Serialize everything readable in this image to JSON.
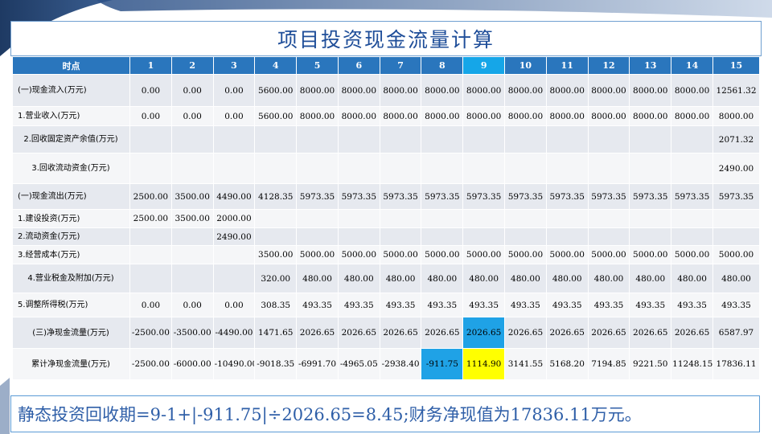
{
  "title": "项目投资现金流量计算",
  "header": {
    "label": "时点",
    "periods": [
      "1",
      "2",
      "3",
      "4",
      "5",
      "6",
      "7",
      "8",
      "9",
      "10",
      "11",
      "12",
      "13",
      "14",
      "15"
    ]
  },
  "rows": [
    {
      "label": "(一)现金流入(万元)",
      "values": [
        "0.00",
        "0.00",
        "0.00",
        "5600.00",
        "8000.00",
        "8000.00",
        "8000.00",
        "8000.00",
        "8000.00",
        "8000.00",
        "8000.00",
        "8000.00",
        "8000.00",
        "8000.00",
        "12561.32"
      ]
    },
    {
      "label": "1.营业收入(万元)",
      "values": [
        "0.00",
        "0.00",
        "0.00",
        "5600.00",
        "8000.00",
        "8000.00",
        "8000.00",
        "8000.00",
        "8000.00",
        "8000.00",
        "8000.00",
        "8000.00",
        "8000.00",
        "8000.00",
        "8000.00"
      ]
    },
    {
      "label": "2.回收固定资产余值(万元)",
      "values": [
        "",
        "",
        "",
        "",
        "",
        "",
        "",
        "",
        "",
        "",
        "",
        "",
        "",
        "",
        "2071.32"
      ]
    },
    {
      "label": "3.回收流动资金(万元)",
      "values": [
        "",
        "",
        "",
        "",
        "",
        "",
        "",
        "",
        "",
        "",
        "",
        "",
        "",
        "",
        "2490.00"
      ]
    },
    {
      "label": "(一)现金流出(万元)",
      "values": [
        "2500.00",
        "3500.00",
        "4490.00",
        "4128.35",
        "5973.35",
        "5973.35",
        "5973.35",
        "5973.35",
        "5973.35",
        "5973.35",
        "5973.35",
        "5973.35",
        "5973.35",
        "5973.35",
        "5973.35"
      ]
    },
    {
      "label": "1.建设投资(万元)",
      "values": [
        "2500.00",
        "3500.00",
        "2000.00",
        "",
        "",
        "",
        "",
        "",
        "",
        "",
        "",
        "",
        "",
        "",
        ""
      ]
    },
    {
      "label": "2.流动资金(万元)",
      "values": [
        "",
        "",
        "2490.00",
        "",
        "",
        "",
        "",
        "",
        "",
        "",
        "",
        "",
        "",
        "",
        ""
      ]
    },
    {
      "label": "3.经营成本(万元)",
      "values": [
        "",
        "",
        "",
        "3500.00",
        "5000.00",
        "5000.00",
        "5000.00",
        "5000.00",
        "5000.00",
        "5000.00",
        "5000.00",
        "5000.00",
        "5000.00",
        "5000.00",
        "5000.00"
      ]
    },
    {
      "label": "4.营业税金及附加(万元)",
      "values": [
        "",
        "",
        "",
        "320.00",
        "480.00",
        "480.00",
        "480.00",
        "480.00",
        "480.00",
        "480.00",
        "480.00",
        "480.00",
        "480.00",
        "480.00",
        "480.00"
      ]
    },
    {
      "label": "5.调整所得税(万元)",
      "values": [
        "0.00",
        "0.00",
        "0.00",
        "308.35",
        "493.35",
        "493.35",
        "493.35",
        "493.35",
        "493.35",
        "493.35",
        "493.35",
        "493.35",
        "493.35",
        "493.35",
        "493.35"
      ]
    },
    {
      "label": "(三)净现金流量(万元)",
      "values": [
        "-2500.00",
        "-3500.00",
        "-4490.00",
        "1471.65",
        "2026.65",
        "2026.65",
        "2026.65",
        "2026.65",
        "2026.65",
        "2026.65",
        "2026.65",
        "2026.65",
        "2026.65",
        "2026.65",
        "6587.97"
      ]
    },
    {
      "label": "累计净现金流量(万元)",
      "values": [
        "-2500.00",
        "-6000.00",
        "-10490.00",
        "-9018.35",
        "-6991.70",
        "-4965.05",
        "-2938.40",
        "-911.75",
        "1114.90",
        "3141.55",
        "5168.20",
        "7194.85",
        "9221.50",
        "11248.15",
        "17836.11"
      ]
    }
  ],
  "highlight_colors": {
    "header_current": "#15a6e8",
    "cell_blue": "#1fa2e6",
    "cell_yellow": "#ffff00"
  },
  "footer": "静态投资回收期=9-1+|-911.75|÷2026.65=8.45;财务净现值为17836.11万元。"
}
